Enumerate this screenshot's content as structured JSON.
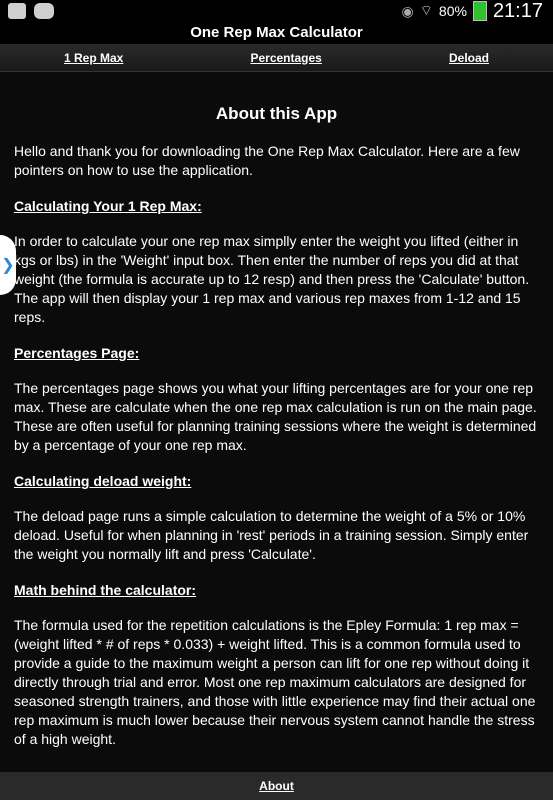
{
  "status": {
    "battery": "80%",
    "time": "21:17"
  },
  "app": {
    "title": "One Rep Max Calculator"
  },
  "tabs": [
    {
      "label": "1 Rep Max"
    },
    {
      "label": "Percentages"
    },
    {
      "label": "Deload"
    }
  ],
  "about": {
    "title": "About this App",
    "intro": "Hello and thank you for downloading the One Rep Max Calculator. Here are a few pointers on how to use the application.",
    "sections": [
      {
        "heading": "Calculating Your 1 Rep Max:",
        "body": "In order to calculate your one rep max simplly enter the weight you lifted (either in kgs or lbs) in the 'Weight' input box. Then enter the number of reps you did at that weight (the formula is accurate up to 12 resp) and then press the 'Calculate' button. The app will then display your 1 rep max and various rep maxes from 1-12 and 15 reps."
      },
      {
        "heading": "Percentages Page:",
        "body": "The percentages page shows you what your lifting percentages are for your one rep max. These are calculate when the one rep max calculation is run on the main page. These are often useful for planning training sessions where the weight is determined by a percentage of your one rep max."
      },
      {
        "heading": "Calculating deload weight:",
        "body": "The deload page runs a simple calculation to determine the weight of a 5% or 10% deload. Useful for when planning in 'rest' periods in a training session. Simply enter the weight you normally lift and press 'Calculate'."
      },
      {
        "heading": "Math behind the calculator:",
        "body": "The formula used for the repetition calculations is the Epley Formula: 1 rep max = (weight lifted * # of reps * 0.033) + weight lifted. This is a common formula used to provide a guide to the maximum weight a person can lift for one rep without doing it directly through trial and error. Most one rep maximum calculators are designed for seasoned strength trainers, and those with little experience may find their actual one rep maximum is much lower because their nervous system cannot handle the stress of a high weight."
      }
    ]
  },
  "bottom": {
    "about_label": "About"
  },
  "icons": {
    "side_handle": "chevron-right-icon"
  }
}
